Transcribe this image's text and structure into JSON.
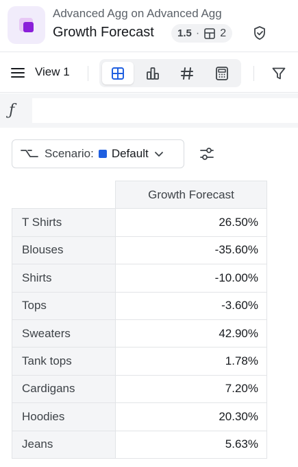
{
  "header": {
    "subtitle": "Advanced Agg on Advanced Agg",
    "title": "Growth Forecast",
    "version": "1.5",
    "version_separator": "·",
    "tables_count": "2",
    "brand_color": "#8a1fd9"
  },
  "toolbar": {
    "view_label": "View 1",
    "view_modes": [
      "grid-icon",
      "chart-icon",
      "number-icon",
      "calculator-icon"
    ],
    "active_view_mode": "grid-icon",
    "accent_color": "#1f5fe0"
  },
  "formula_bar": {
    "icon_label": "ƒ",
    "value": ""
  },
  "scenario": {
    "label": "Scenario:",
    "value": "Default",
    "swatch_color": "#1f5fe0"
  },
  "table": {
    "column_header": "Growth Forecast",
    "rows": [
      {
        "label": "T Shirts",
        "value": "26.50%"
      },
      {
        "label": "Blouses",
        "value": "-35.60%"
      },
      {
        "label": "Shirts",
        "value": "-10.00%"
      },
      {
        "label": "Tops",
        "value": "-3.60%"
      },
      {
        "label": "Sweaters",
        "value": "42.90%"
      },
      {
        "label": "Tank tops",
        "value": "1.78%"
      },
      {
        "label": "Cardigans",
        "value": "7.20%"
      },
      {
        "label": "Hoodies",
        "value": "20.30%"
      },
      {
        "label": "Jeans",
        "value": "5.63%"
      }
    ]
  }
}
